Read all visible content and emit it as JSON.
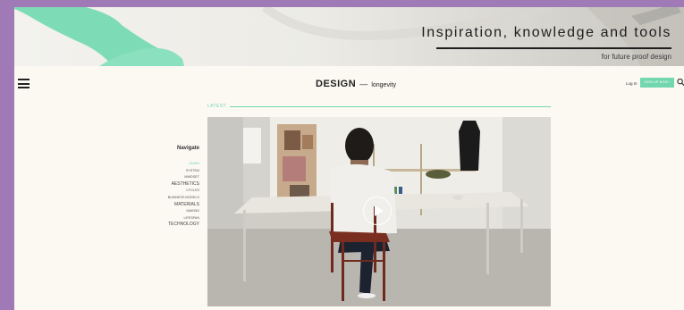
{
  "banner": {
    "title": "Inspiration, knowledge and tools",
    "subtitle": "for future proof design"
  },
  "header": {
    "logo_main": "DESIGN",
    "logo_dash": "—",
    "logo_sub": "longevity",
    "login": "Log In",
    "signup": "SIGN UP NOW ›"
  },
  "latest": {
    "label": "LATEST"
  },
  "navigate": {
    "title": "Navigate",
    "items": [
      {
        "label": "LEARN"
      },
      {
        "label": "SYSTEM"
      },
      {
        "label": "MINDSET"
      },
      {
        "label": "AESTHETICS"
      },
      {
        "label": "CYCLES"
      },
      {
        "label": "BUSINESS MODELS"
      },
      {
        "label": "MATERIALS"
      },
      {
        "label": "MAKING"
      },
      {
        "label": "LIFESPAN"
      },
      {
        "label": "TECHNOLOGY"
      }
    ]
  },
  "icons": {
    "menu": "hamburger-icon",
    "search": "search-icon",
    "play": "play-icon"
  },
  "colors": {
    "accent": "#72d7ad",
    "frame": "#a07ab6",
    "page": "#fcf9f3"
  }
}
